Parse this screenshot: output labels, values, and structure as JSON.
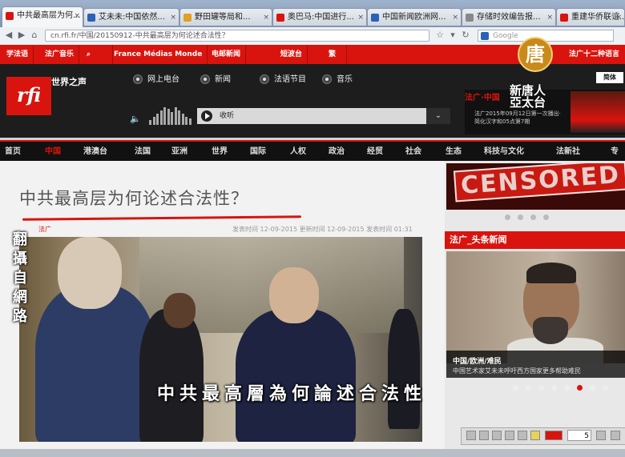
{
  "browser": {
    "tabs": [
      {
        "label": "中共最高层为何...",
        "active": true,
        "favicon_color": "#d9140e"
      },
      {
        "label": "艾未未:中国依然...",
        "active": false,
        "favicon_color": "#2a62b8"
      },
      {
        "label": "野田罐等局和...",
        "active": false,
        "favicon_color": "#e0a020"
      },
      {
        "label": "奥巴马:中国进行...",
        "active": false,
        "favicon_color": "#d9140e"
      },
      {
        "label": "中国新闻欧洲网...",
        "active": false,
        "favicon_color": "#2a62b8"
      },
      {
        "label": "存储时效编告报...",
        "active": false,
        "favicon_color": "#888888"
      },
      {
        "label": "重建华侨联谊...",
        "active": false,
        "favicon_color": "#d9140e"
      }
    ],
    "url": "cn.rfi.fr/中国/20150912-中共最高层为何论述合法性？",
    "search_placeholder": "Google"
  },
  "rfi_topbar": {
    "items": [
      "学法语",
      "法广音乐",
      "France Médias Monde",
      "电邮新闻",
      "短波台",
      "繁"
    ],
    "right_label": "法广十二种语言"
  },
  "rfi_header": {
    "logo_text": "rfi",
    "logo_sub": "法广",
    "site_label": "世界之声",
    "radios": [
      "网上电台",
      "新闻",
      "法语节目",
      "音乐"
    ],
    "player_label": "收听",
    "lang_box": "简体",
    "ad_red": "法广·中国",
    "ad_text": "法广2015年09月12日第一次播出·简化汉字和05点第7期"
  },
  "main_nav": {
    "items": [
      "首页",
      "中国",
      "港澳台",
      "法国",
      "亚洲",
      "世界",
      "国际",
      "人权",
      "政治",
      "经贸",
      "社会",
      "生态",
      "科技与文化",
      "法新社",
      "专"
    ],
    "active_index": 1
  },
  "article": {
    "title": "中共最高层为何论述合法性？",
    "meta_left": "法广",
    "meta": "发表时间 12-09-2015 更新时间 12-09-2015 发表时间 01:31"
  },
  "video_overlay": {
    "subtitle": "中共最高層為何論述合法性",
    "vertical_label": "翻攝自網路",
    "ntd_logo_char": "唐",
    "ntd_name": "新唐人亞太台"
  },
  "sidebar": {
    "banner_word": "CENSORED",
    "headline_bar": "法广_头条新闻",
    "caption_tag": "中国/欧洲/难民",
    "caption_text": "中国艺术家艾未未呼吁西方国家更多帮助难民",
    "slider_dots": 8,
    "active_dot": 5,
    "toolbar_number": "5"
  },
  "colors": {
    "rfi_red": "#d9140e",
    "header_dark": "#1d1d1d",
    "nav_black": "#111111"
  }
}
